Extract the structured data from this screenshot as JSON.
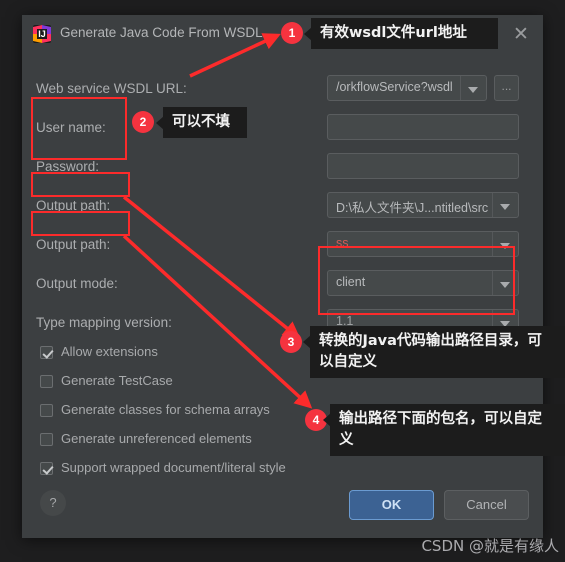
{
  "window": {
    "title": "Generate Java Code From WSDL",
    "app_icon": "intellij-idea-icon",
    "close_icon": "close-icon"
  },
  "form": {
    "wsdl_url": {
      "label": "Web service WSDL URL:",
      "value": "/orkflowService?wsdl",
      "browse_label": "...",
      "dropdown_icon": "chevron-down-icon"
    },
    "user_name": {
      "label": "User name:",
      "value": "",
      "placeholder": ""
    },
    "password": {
      "label": "Password:",
      "value": "",
      "placeholder": ""
    },
    "output_path": {
      "label": "Output path:",
      "value": "D:\\私人文件夹\\J...ntitled\\src",
      "dropdown_icon": "chevron-down-icon"
    },
    "output_package": {
      "label": "Output path:",
      "value": "ss",
      "value_is_error": true,
      "dropdown_icon": "chevron-down-icon"
    },
    "output_mode": {
      "label": "Output mode:",
      "value": "client",
      "dropdown_icon": "chevron-down-icon"
    },
    "type_mapping_version": {
      "label": "Type mapping version:",
      "value": "1.1",
      "dropdown_icon": "chevron-down-icon"
    },
    "checkboxes": [
      {
        "label": "Allow extensions",
        "checked": true
      },
      {
        "label": "Generate TestCase",
        "checked": false
      },
      {
        "label": "Generate classes for schema arrays",
        "checked": false
      },
      {
        "label": "Generate unreferenced elements",
        "checked": false
      },
      {
        "label": "Support wrapped document/literal style",
        "checked": true
      }
    ]
  },
  "footer": {
    "help_label": "?",
    "ok_label": "OK",
    "cancel_label": "Cancel"
  },
  "annotations": {
    "accent_color": "#f5333f",
    "callout_bg": "#1c1c1c",
    "items": [
      {
        "badge": "1",
        "text": "有效wsdl文件url地址"
      },
      {
        "badge": "2",
        "text": "可以不填"
      },
      {
        "badge": "3",
        "text": "转换的Java代码输出路径目录，可以自定义"
      },
      {
        "badge": "4",
        "text": "输出路径下面的包名，可以自定义"
      }
    ]
  },
  "watermark": {
    "text": "CSDN @就是有缘人"
  }
}
